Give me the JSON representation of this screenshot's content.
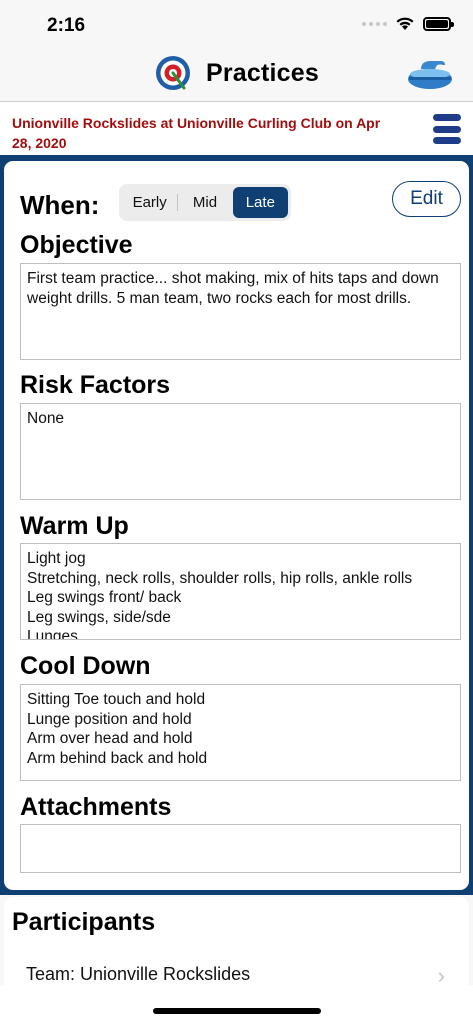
{
  "status_bar": {
    "time": "2:16"
  },
  "nav": {
    "title": "Practices"
  },
  "subheader": {
    "text": "Unionville Rockslides at Unionville Curling Club on Apr 28, 2020"
  },
  "when": {
    "label": "When:",
    "options": [
      "Early",
      "Mid",
      "Late"
    ],
    "selected": "Late"
  },
  "edit_label": "Edit",
  "sections": {
    "objective": {
      "title": "Objective",
      "text": "First team practice... shot making, mix of hits taps and down weight drills. 5 man team, two rocks each for most drills."
    },
    "risk_factors": {
      "title": "Risk Factors",
      "text": "None"
    },
    "warm_up": {
      "title": "Warm Up",
      "text": "Light jog\nStretching, neck rolls, shoulder rolls, hip rolls, ankle rolls\nLeg swings front/ back\nLeg swings, side/sde\nLunges"
    },
    "cool_down": {
      "title": "Cool Down",
      "text": "Sitting Toe touch and hold\nLunge position and hold\nArm over head and hold\nArm behind back and hold"
    },
    "attachments": {
      "title": "Attachments",
      "text": ""
    }
  },
  "participants": {
    "title": "Participants",
    "team_row": "Team: Unionville Rockslides"
  },
  "colors": {
    "brand_navy": "#0f3f73",
    "subheader_red": "#a10e0e",
    "menu_blue": "#1e3c8a"
  }
}
